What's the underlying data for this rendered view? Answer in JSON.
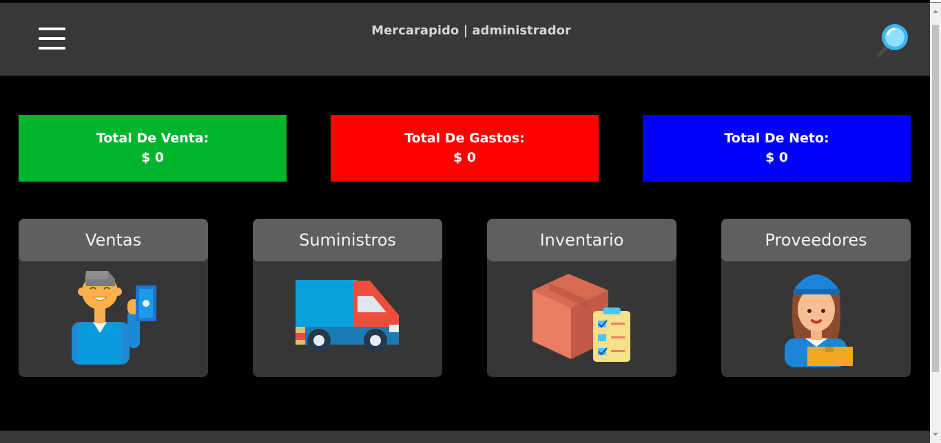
{
  "header": {
    "title": "Mercarapido | administrador",
    "menu_icon": "hamburger-menu-icon",
    "search_icon": "magnifying-glass-icon"
  },
  "stats": [
    {
      "label": "Total De Venta:",
      "value": "$ 0",
      "color": "#00b42c"
    },
    {
      "label": "Total De Gastos:",
      "value": "$ 0",
      "color": "#ff0000"
    },
    {
      "label": "Total De Neto:",
      "value": "$ 0",
      "color": "#0000ff"
    }
  ],
  "modules": [
    {
      "label": "Ventas",
      "icon": "salesman-holding-cash-icon"
    },
    {
      "label": "Suministros",
      "icon": "delivery-truck-icon"
    },
    {
      "label": "Inventario",
      "icon": "box-checklist-icon"
    },
    {
      "label": "Proveedores",
      "icon": "delivery-woman-icon"
    }
  ]
}
